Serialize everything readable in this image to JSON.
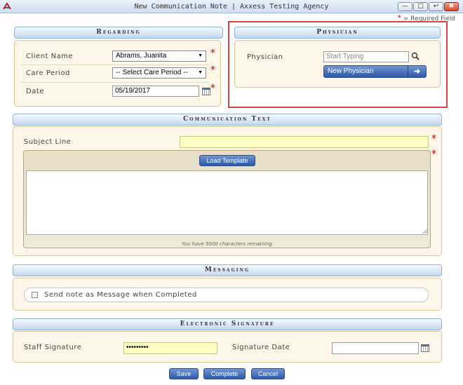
{
  "window": {
    "title": "New Communication Note | Axxess Testing Agency",
    "buttons": [
      "—",
      "□",
      "↩",
      "✖"
    ]
  },
  "required_note": "= Required Field",
  "regarding": {
    "header": "Regarding",
    "client_label": "Client Name",
    "client_value": "Abrams, Juanita",
    "care_period_label": "Care Period",
    "care_period_value": "-- Select Care Period --",
    "date_label": "Date",
    "date_value": "05/19/2017"
  },
  "physician": {
    "header": "Physician",
    "label": "Physician",
    "placeholder": "Start Typing",
    "new_button": "New Physician"
  },
  "communication": {
    "header": "Communication Text",
    "subject_label": "Subject Line",
    "subject_value": "",
    "load_template": "Load Template",
    "chars_remaining": "You have 5000 characters remaining"
  },
  "messaging": {
    "header": "Messaging",
    "checkbox_label": "Send note as Message when Completed",
    "checked": false
  },
  "signature": {
    "header": "Electronic Signature",
    "staff_label": "Staff Signature",
    "staff_value": "•••••••••",
    "date_label": "Signature Date",
    "date_value": ""
  },
  "actions": {
    "save": "Save",
    "complete": "Complete",
    "cancel": "Cancel"
  },
  "colors": {
    "accent_blue": "#2f5aa6",
    "panel_bg": "#fdf6e9",
    "required_red": "#cc0000",
    "highlight_red": "#d9433f",
    "field_yellow": "#fdfdc4"
  }
}
